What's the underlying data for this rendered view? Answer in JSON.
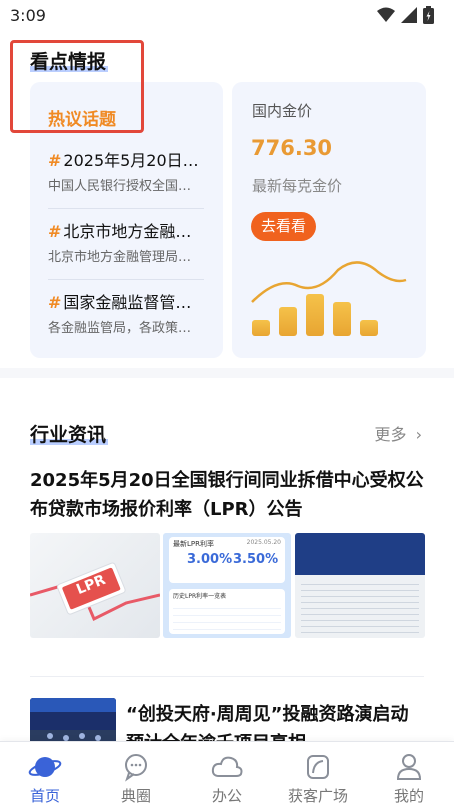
{
  "status_bar": {
    "time": "3:09"
  },
  "section1": {
    "title": "看点情报",
    "hot": {
      "title": "热议话题",
      "items": [
        {
          "hash": "#",
          "title": "2025年5月20日…",
          "subtitle": "中国人民银行授权全国…"
        },
        {
          "hash": "#",
          "title": "北京市地方金融…",
          "subtitle": "北京市地方金融管理局…"
        },
        {
          "hash": "#",
          "title": "国家金融监督管…",
          "subtitle": "各金融监管局，各政策…"
        }
      ]
    },
    "gold": {
      "label": "国内金价",
      "price": "776.30",
      "subtitle": "最新每克金价",
      "button": "去看看",
      "bar_levels": [
        0.3,
        0.55,
        0.8,
        0.65,
        0.3
      ]
    }
  },
  "news": {
    "title": "行业资讯",
    "more": "更多",
    "article1": {
      "title": "2025年5月20日全国银行间同业拆借中心受权公布贷款市场报价利率（LPR）公告",
      "images": {
        "lpr_tag": "LPR",
        "card_head": "最新LPR利率",
        "card_date": "2025.05.20",
        "rate_1y": "3.00%",
        "rate_5y": "3.50%",
        "history_head": "历史LPR利率一览表"
      }
    },
    "article2": {
      "title": "“创投天府·周周见”投融资路演启动预计全年逾千项目亮相"
    }
  },
  "tabbar": {
    "items": [
      {
        "label": "首页",
        "icon": "planet-icon",
        "active": true
      },
      {
        "label": "典圈",
        "icon": "chat-bubble-icon",
        "active": false
      },
      {
        "label": "办公",
        "icon": "cloud-icon",
        "active": false
      },
      {
        "label": "获客广场",
        "icon": "leaf-icon",
        "active": false
      },
      {
        "label": "我的",
        "icon": "person-icon",
        "active": false
      }
    ]
  },
  "colors": {
    "accent_orange": "#f08a24",
    "button_orange": "#f0621e",
    "gold": "#e99a34",
    "active_blue": "#3a63d8",
    "highlight_red": "#e2473a"
  }
}
